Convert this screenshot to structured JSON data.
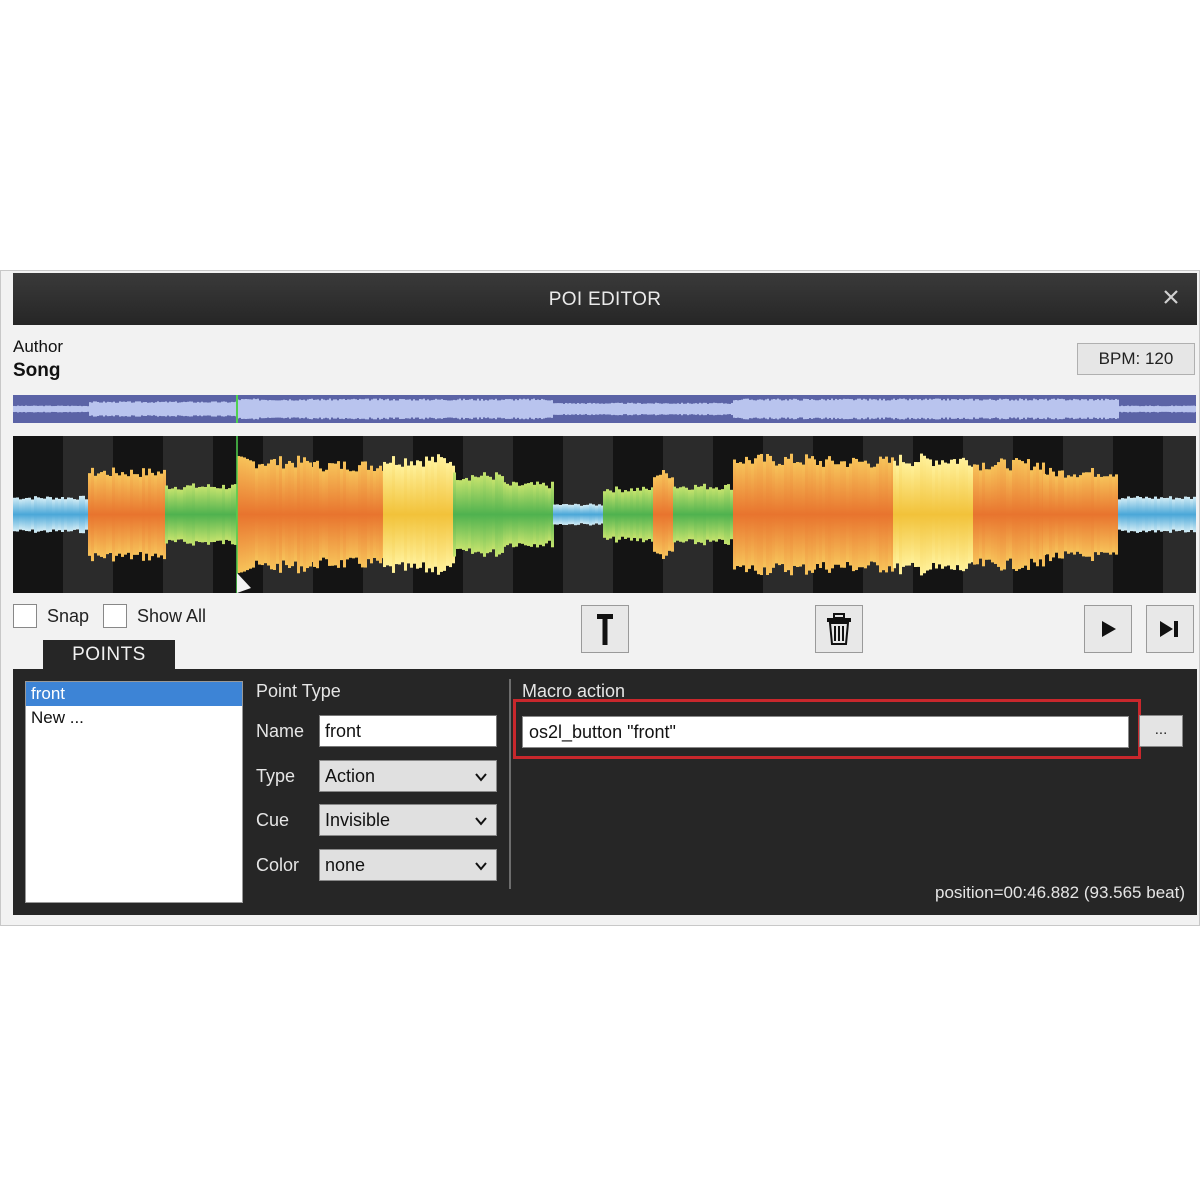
{
  "window": {
    "title": "POI EDITOR",
    "close_icon": "close-icon"
  },
  "track": {
    "author": "Author",
    "song": "Song",
    "bpm": "BPM: 120"
  },
  "toolbar": {
    "snap_label": "Snap",
    "snap_checked": false,
    "show_all_label": "Show All",
    "show_all_checked": false,
    "buttons": [
      "marker-icon",
      "trash-icon",
      "play-icon",
      "skip-end-icon"
    ]
  },
  "tabs": {
    "points_label": "POINTS"
  },
  "points_list": {
    "items": [
      {
        "label": "front",
        "selected": true
      },
      {
        "label": "New ...",
        "selected": false
      }
    ]
  },
  "point": {
    "section_title": "Point Type",
    "name_label": "Name",
    "name_value": "front",
    "type_label": "Type",
    "type_value": "Action",
    "cue_label": "Cue",
    "cue_value": "Invisible",
    "color_label": "Color",
    "color_value": "none"
  },
  "macro": {
    "label": "Macro action",
    "value": "os2l_button \"front\"",
    "browse_label": "...",
    "highlight_color": "#c8272c"
  },
  "status": {
    "position": "position=00:46.882 (93.565 beat)"
  },
  "colors": {
    "titlebar": "#2e2e2e",
    "panel": "#262626",
    "selected": "#3d84d6",
    "overview": "#5b63a6"
  }
}
